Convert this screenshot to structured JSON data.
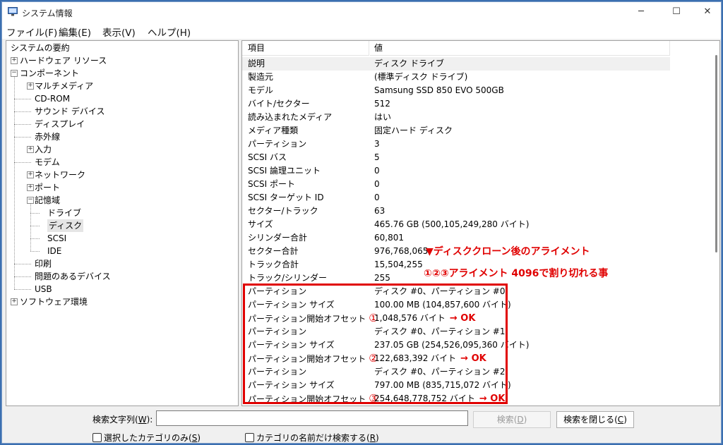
{
  "window": {
    "title": "システム情報",
    "controls": {
      "minimize": "─",
      "maximize": "☐",
      "close": "✕"
    }
  },
  "menu": [
    "ファイル(F)",
    "編集(E)",
    "表示(V)",
    "ヘルプ(H)"
  ],
  "tree": [
    {
      "label": "システムの要約",
      "level": 0,
      "expander": "none"
    },
    {
      "label": "ハードウェア リソース",
      "level": 0,
      "expander": "plus"
    },
    {
      "label": "コンポーネント",
      "level": 0,
      "expander": "minus"
    },
    {
      "label": "マルチメディア",
      "level": 1,
      "expander": "plus"
    },
    {
      "label": "CD-ROM",
      "level": 1,
      "expander": "none"
    },
    {
      "label": "サウンド デバイス",
      "level": 1,
      "expander": "none"
    },
    {
      "label": "ディスプレイ",
      "level": 1,
      "expander": "none"
    },
    {
      "label": "赤外線",
      "level": 1,
      "expander": "none"
    },
    {
      "label": "入力",
      "level": 1,
      "expander": "plus"
    },
    {
      "label": "モデム",
      "level": 1,
      "expander": "none"
    },
    {
      "label": "ネットワーク",
      "level": 1,
      "expander": "plus"
    },
    {
      "label": "ポート",
      "level": 1,
      "expander": "plus"
    },
    {
      "label": "記憶域",
      "level": 1,
      "expander": "minus"
    },
    {
      "label": "ドライブ",
      "level": 2,
      "expander": "none"
    },
    {
      "label": "ディスク",
      "level": 2,
      "expander": "none",
      "selected": true
    },
    {
      "label": "SCSI",
      "level": 2,
      "expander": "none"
    },
    {
      "label": "IDE",
      "level": 2,
      "expander": "none"
    },
    {
      "label": "印刷",
      "level": 1,
      "expander": "none"
    },
    {
      "label": "問題のあるデバイス",
      "level": 1,
      "expander": "none"
    },
    {
      "label": "USB",
      "level": 1,
      "expander": "none"
    },
    {
      "label": "ソフトウェア環境",
      "level": 0,
      "expander": "plus"
    }
  ],
  "details": {
    "columns": [
      "項目",
      "値"
    ],
    "rows": [
      {
        "k": "説明",
        "v": "ディスク ドライブ",
        "sel": true
      },
      {
        "k": "製造元",
        "v": "(標準ディスク ドライブ)"
      },
      {
        "k": "モデル",
        "v": "Samsung SSD 850 EVO 500GB"
      },
      {
        "k": "バイト/セクター",
        "v": "512"
      },
      {
        "k": "読み込まれたメディア",
        "v": "はい"
      },
      {
        "k": "メディア種類",
        "v": "固定ハード ディスク"
      },
      {
        "k": "パーティション",
        "v": "3"
      },
      {
        "k": "SCSI バス",
        "v": "5"
      },
      {
        "k": "SCSI 論理ユニット",
        "v": "0"
      },
      {
        "k": "SCSI ポート",
        "v": "0"
      },
      {
        "k": "SCSI ターゲット ID",
        "v": "0"
      },
      {
        "k": "セクター/トラック",
        "v": "63"
      },
      {
        "k": "サイズ",
        "v": "465.76 GB (500,105,249,280 バイト)"
      },
      {
        "k": "シリンダー合計",
        "v": "60,801"
      },
      {
        "k": "セクター合計",
        "v": "976,768,065"
      },
      {
        "k": "トラック合計",
        "v": "15,504,255"
      },
      {
        "k": "トラック/シリンダー",
        "v": "255"
      },
      {
        "k": "パーティション",
        "v": "ディスク #0、パーティション #0"
      },
      {
        "k": "パーティション サイズ",
        "v": "100.00 MB (104,857,600 バイト)"
      },
      {
        "k": "パーティション開始オフセット",
        "v": "1,048,576 バイト",
        "mark": "①",
        "ok": "→ OK"
      },
      {
        "k": "パーティション",
        "v": "ディスク #0、パーティション #1"
      },
      {
        "k": "パーティション サイズ",
        "v": "237.05 GB (254,526,095,360 バイト)"
      },
      {
        "k": "パーティション開始オフセット",
        "v": "122,683,392 バイト",
        "mark": "②",
        "ok": "→ OK"
      },
      {
        "k": "パーティション",
        "v": "ディスク #0、パーティション #2"
      },
      {
        "k": "パーティション サイズ",
        "v": "797.00 MB (835,715,072 バイト)"
      },
      {
        "k": "パーティション開始オフセット",
        "v": "254,648,778,752 バイト",
        "mark": "③",
        "ok": "→ OK"
      }
    ]
  },
  "annotations": {
    "line1": "▼ディスククローン後のアライメント",
    "line2": "①②③アライメント 4096で割り切れる事"
  },
  "search": {
    "label_pre": "検索文字列(",
    "label_key": "W",
    "label_post": "):",
    "value": "",
    "find_pre": "検索(",
    "find_key": "D",
    "find_post": ")",
    "close_pre": "検索を閉じる(",
    "close_key": "C",
    "close_post": ")",
    "chk1_pre": "選択したカテゴリのみ(",
    "chk1_key": "S",
    "chk1_post": ")",
    "chk2_pre": "カテゴリの名前だけ検索する(",
    "chk2_key": "R",
    "chk2_post": ")"
  }
}
